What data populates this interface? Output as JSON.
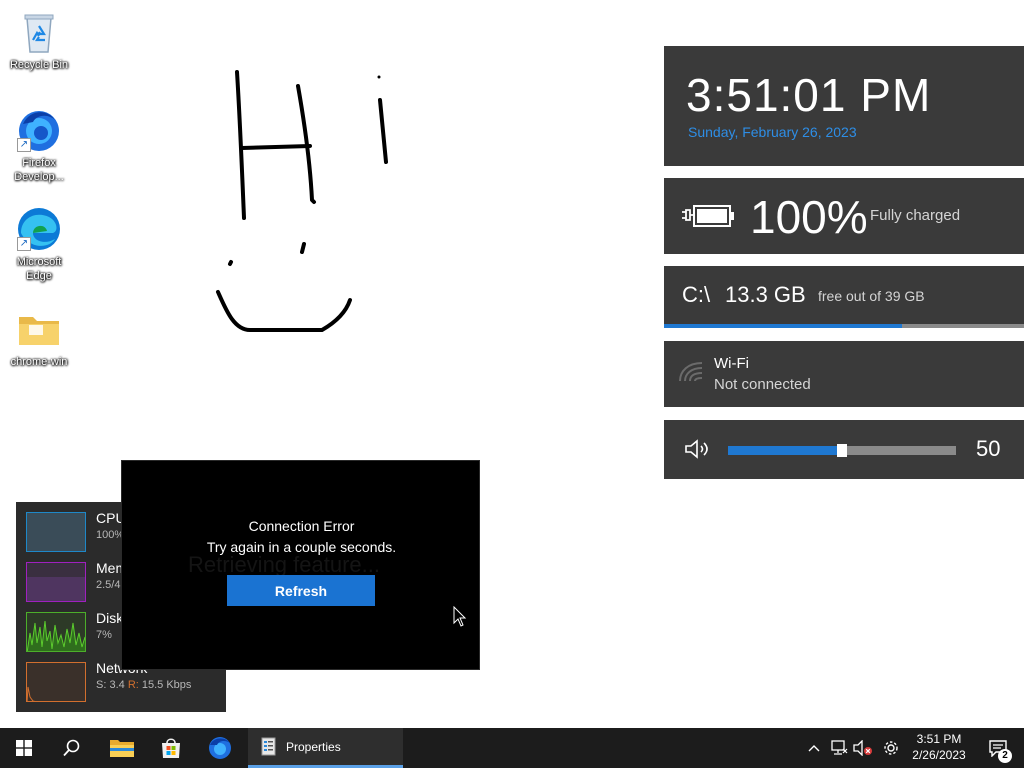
{
  "desktop": {
    "icons": [
      {
        "label": "Recycle Bin"
      },
      {
        "label": "Firefox Develop..."
      },
      {
        "label": "Microsoft Edge"
      },
      {
        "label": "chrome-win"
      }
    ]
  },
  "widgets": {
    "clock": {
      "time": "3:51:01 PM",
      "date": "Sunday, February 26, 2023",
      "date_color": "#2e8ee6"
    },
    "battery": {
      "percent": "100%",
      "status": "Fully charged",
      "icon": "battery-plug-icon"
    },
    "disk": {
      "drive": "C:\\",
      "free": "13.3 GB",
      "of_text": "free out of 39 GB",
      "used_fraction": 0.66
    },
    "wifi": {
      "name": "Wi-Fi",
      "status": "Not connected",
      "icon": "wifi-icon"
    },
    "volume": {
      "value": "50",
      "level_fraction": 0.5,
      "icon": "speaker-icon"
    }
  },
  "resource_monitor": {
    "rows": [
      {
        "name": "CPU",
        "value": "100%",
        "color": "#1e88c8"
      },
      {
        "name": "Mem",
        "value": "2.5/4",
        "color": "#a020c0"
      },
      {
        "name": "Disk",
        "value": "7%",
        "color": "#4caf2a"
      },
      {
        "name": "Network",
        "value_s": "S: 3.4",
        "value_r_label": "R:",
        "value_r": "15.5 Kbps",
        "color": "#d26f2e"
      }
    ]
  },
  "dialog": {
    "ghost_text": "Retrieving feature...",
    "title": "Connection Error",
    "message": "Try again in a couple seconds.",
    "refresh_label": "Refresh",
    "accent": "#1a73d2"
  },
  "taskbar": {
    "properties_label": "Properties",
    "clock_time": "3:51 PM",
    "clock_date": "2/26/2023",
    "notification_count": "2"
  }
}
